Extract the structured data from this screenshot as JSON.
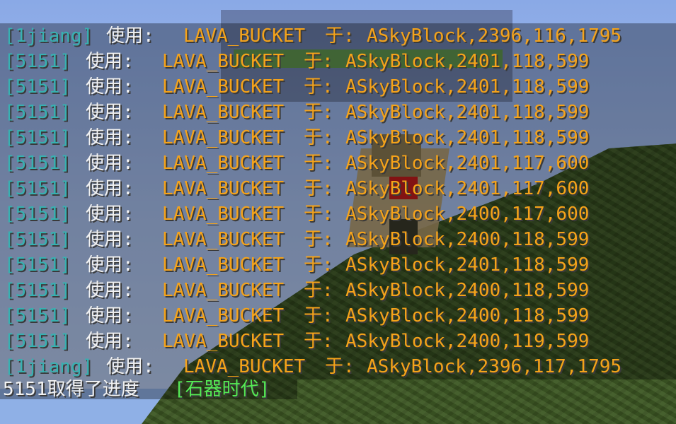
{
  "colors": {
    "player": "#37b1b1",
    "verb": "#f2f2f2",
    "highlight": "#f5a31a",
    "advancement": "#55e955"
  },
  "chat": [
    {
      "player": "[1jiang]",
      "verb": "使用:",
      "item": "LAVA_BUCKET",
      "sep": "于:",
      "location": "ASkyBlock,2396,116,1795"
    },
    {
      "player": "[5151]",
      "verb": "使用:",
      "item": "LAVA_BUCKET",
      "sep": "于:",
      "location": "ASkyBlock,2401,118,599"
    },
    {
      "player": "[5151]",
      "verb": "使用:",
      "item": "LAVA_BUCKET",
      "sep": "于:",
      "location": "ASkyBlock,2401,118,599"
    },
    {
      "player": "[5151]",
      "verb": "使用:",
      "item": "LAVA_BUCKET",
      "sep": "于:",
      "location": "ASkyBlock,2401,118,599"
    },
    {
      "player": "[5151]",
      "verb": "使用:",
      "item": "LAVA_BUCKET",
      "sep": "于:",
      "location": "ASkyBlock,2401,118,599"
    },
    {
      "player": "[5151]",
      "verb": "使用:",
      "item": "LAVA_BUCKET",
      "sep": "于:",
      "location": "ASkyBlock,2401,117,600"
    },
    {
      "player": "[5151]",
      "verb": "使用:",
      "item": "LAVA_BUCKET",
      "sep": "于:",
      "location": "ASkyBlock,2401,117,600"
    },
    {
      "player": "[5151]",
      "verb": "使用:",
      "item": "LAVA_BUCKET",
      "sep": "于:",
      "location": "ASkyBlock,2400,117,600"
    },
    {
      "player": "[5151]",
      "verb": "使用:",
      "item": "LAVA_BUCKET",
      "sep": "于:",
      "location": "ASkyBlock,2400,118,599"
    },
    {
      "player": "[5151]",
      "verb": "使用:",
      "item": "LAVA_BUCKET",
      "sep": "于:",
      "location": "ASkyBlock,2401,118,599"
    },
    {
      "player": "[5151]",
      "verb": "使用:",
      "item": "LAVA_BUCKET",
      "sep": "于:",
      "location": "ASkyBlock,2400,118,599"
    },
    {
      "player": "[5151]",
      "verb": "使用:",
      "item": "LAVA_BUCKET",
      "sep": "于:",
      "location": "ASkyBlock,2400,118,599"
    },
    {
      "player": "[5151]",
      "verb": "使用:",
      "item": "LAVA_BUCKET",
      "sep": "于:",
      "location": "ASkyBlock,2400,119,599"
    },
    {
      "player": "[1jiang]",
      "verb": "使用:",
      "item": "LAVA_BUCKET",
      "sep": "于:",
      "location": "ASkyBlock,2396,117,1795"
    }
  ],
  "partial_line": {
    "text": "5151取得了进度",
    "advancement": "[石器时代]"
  }
}
